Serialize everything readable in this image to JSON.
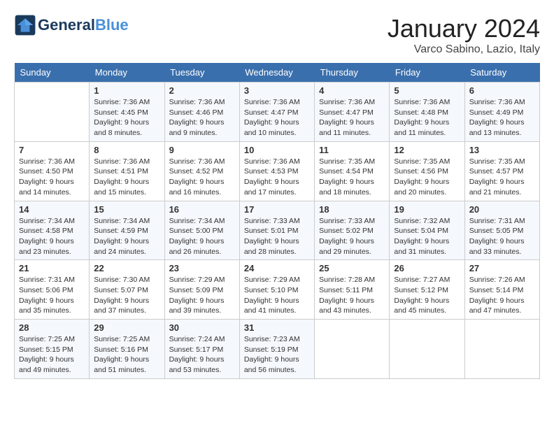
{
  "header": {
    "logo_general": "General",
    "logo_blue": "Blue",
    "month": "January 2024",
    "location": "Varco Sabino, Lazio, Italy"
  },
  "weekdays": [
    "Sunday",
    "Monday",
    "Tuesday",
    "Wednesday",
    "Thursday",
    "Friday",
    "Saturday"
  ],
  "weeks": [
    [
      {
        "day": "",
        "info": ""
      },
      {
        "day": "1",
        "info": "Sunrise: 7:36 AM\nSunset: 4:45 PM\nDaylight: 9 hours\nand 8 minutes."
      },
      {
        "day": "2",
        "info": "Sunrise: 7:36 AM\nSunset: 4:46 PM\nDaylight: 9 hours\nand 9 minutes."
      },
      {
        "day": "3",
        "info": "Sunrise: 7:36 AM\nSunset: 4:47 PM\nDaylight: 9 hours\nand 10 minutes."
      },
      {
        "day": "4",
        "info": "Sunrise: 7:36 AM\nSunset: 4:47 PM\nDaylight: 9 hours\nand 11 minutes."
      },
      {
        "day": "5",
        "info": "Sunrise: 7:36 AM\nSunset: 4:48 PM\nDaylight: 9 hours\nand 11 minutes."
      },
      {
        "day": "6",
        "info": "Sunrise: 7:36 AM\nSunset: 4:49 PM\nDaylight: 9 hours\nand 13 minutes."
      }
    ],
    [
      {
        "day": "7",
        "info": "Sunrise: 7:36 AM\nSunset: 4:50 PM\nDaylight: 9 hours\nand 14 minutes."
      },
      {
        "day": "8",
        "info": "Sunrise: 7:36 AM\nSunset: 4:51 PM\nDaylight: 9 hours\nand 15 minutes."
      },
      {
        "day": "9",
        "info": "Sunrise: 7:36 AM\nSunset: 4:52 PM\nDaylight: 9 hours\nand 16 minutes."
      },
      {
        "day": "10",
        "info": "Sunrise: 7:36 AM\nSunset: 4:53 PM\nDaylight: 9 hours\nand 17 minutes."
      },
      {
        "day": "11",
        "info": "Sunrise: 7:35 AM\nSunset: 4:54 PM\nDaylight: 9 hours\nand 18 minutes."
      },
      {
        "day": "12",
        "info": "Sunrise: 7:35 AM\nSunset: 4:56 PM\nDaylight: 9 hours\nand 20 minutes."
      },
      {
        "day": "13",
        "info": "Sunrise: 7:35 AM\nSunset: 4:57 PM\nDaylight: 9 hours\nand 21 minutes."
      }
    ],
    [
      {
        "day": "14",
        "info": "Sunrise: 7:34 AM\nSunset: 4:58 PM\nDaylight: 9 hours\nand 23 minutes."
      },
      {
        "day": "15",
        "info": "Sunrise: 7:34 AM\nSunset: 4:59 PM\nDaylight: 9 hours\nand 24 minutes."
      },
      {
        "day": "16",
        "info": "Sunrise: 7:34 AM\nSunset: 5:00 PM\nDaylight: 9 hours\nand 26 minutes."
      },
      {
        "day": "17",
        "info": "Sunrise: 7:33 AM\nSunset: 5:01 PM\nDaylight: 9 hours\nand 28 minutes."
      },
      {
        "day": "18",
        "info": "Sunrise: 7:33 AM\nSunset: 5:02 PM\nDaylight: 9 hours\nand 29 minutes."
      },
      {
        "day": "19",
        "info": "Sunrise: 7:32 AM\nSunset: 5:04 PM\nDaylight: 9 hours\nand 31 minutes."
      },
      {
        "day": "20",
        "info": "Sunrise: 7:31 AM\nSunset: 5:05 PM\nDaylight: 9 hours\nand 33 minutes."
      }
    ],
    [
      {
        "day": "21",
        "info": "Sunrise: 7:31 AM\nSunset: 5:06 PM\nDaylight: 9 hours\nand 35 minutes."
      },
      {
        "day": "22",
        "info": "Sunrise: 7:30 AM\nSunset: 5:07 PM\nDaylight: 9 hours\nand 37 minutes."
      },
      {
        "day": "23",
        "info": "Sunrise: 7:29 AM\nSunset: 5:09 PM\nDaylight: 9 hours\nand 39 minutes."
      },
      {
        "day": "24",
        "info": "Sunrise: 7:29 AM\nSunset: 5:10 PM\nDaylight: 9 hours\nand 41 minutes."
      },
      {
        "day": "25",
        "info": "Sunrise: 7:28 AM\nSunset: 5:11 PM\nDaylight: 9 hours\nand 43 minutes."
      },
      {
        "day": "26",
        "info": "Sunrise: 7:27 AM\nSunset: 5:12 PM\nDaylight: 9 hours\nand 45 minutes."
      },
      {
        "day": "27",
        "info": "Sunrise: 7:26 AM\nSunset: 5:14 PM\nDaylight: 9 hours\nand 47 minutes."
      }
    ],
    [
      {
        "day": "28",
        "info": "Sunrise: 7:25 AM\nSunset: 5:15 PM\nDaylight: 9 hours\nand 49 minutes."
      },
      {
        "day": "29",
        "info": "Sunrise: 7:25 AM\nSunset: 5:16 PM\nDaylight: 9 hours\nand 51 minutes."
      },
      {
        "day": "30",
        "info": "Sunrise: 7:24 AM\nSunset: 5:17 PM\nDaylight: 9 hours\nand 53 minutes."
      },
      {
        "day": "31",
        "info": "Sunrise: 7:23 AM\nSunset: 5:19 PM\nDaylight: 9 hours\nand 56 minutes."
      },
      {
        "day": "",
        "info": ""
      },
      {
        "day": "",
        "info": ""
      },
      {
        "day": "",
        "info": ""
      }
    ]
  ]
}
